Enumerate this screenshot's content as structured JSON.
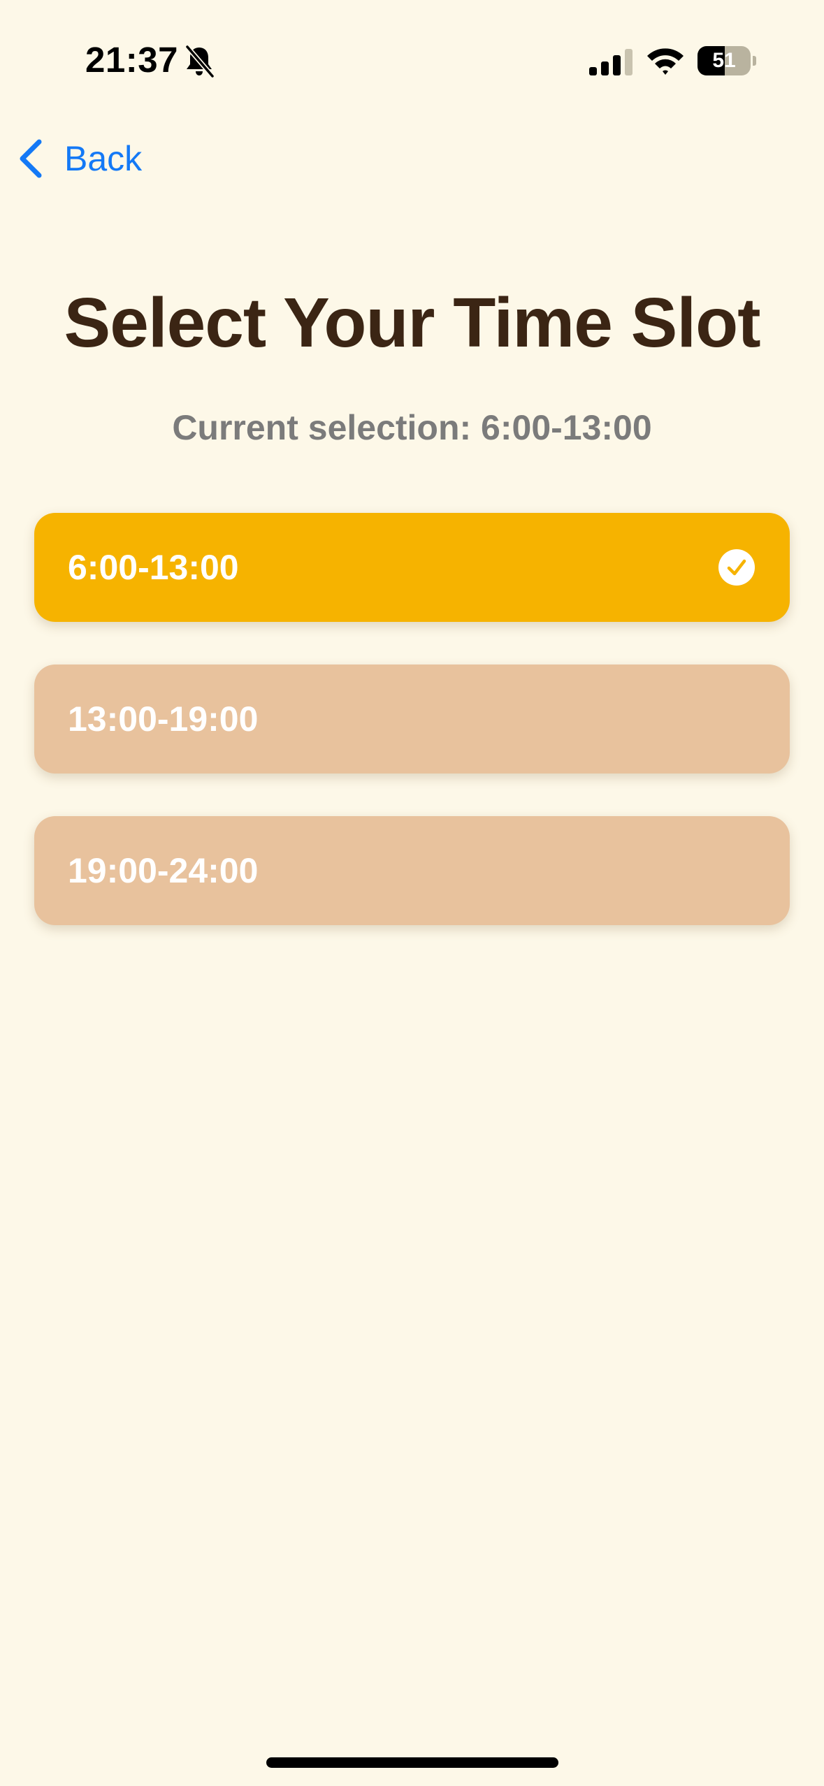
{
  "status_bar": {
    "time": "21:37",
    "battery_level": "51",
    "battery_fraction": 0.51,
    "silent_icon": "bell-slash-icon",
    "signal_icon": "cellular-signal-icon",
    "wifi_icon": "wifi-icon"
  },
  "nav": {
    "back_label": "Back",
    "back_icon": "chevron-left-icon"
  },
  "page": {
    "title": "Select Your Time Slot",
    "current_selection": "Current selection: 6:00-13:00"
  },
  "slots": [
    {
      "label": "6:00-13:00",
      "selected": true
    },
    {
      "label": "13:00-19:00",
      "selected": false
    },
    {
      "label": "19:00-24:00",
      "selected": false
    }
  ],
  "colors": {
    "background": "#FDF8E8",
    "accent_blue": "#1479F6",
    "title": "#3B2514",
    "subtitle": "#7B7B7B",
    "slot_selected": "#F6B300",
    "slot_unselected": "#E8C29D",
    "slot_text": "#FFFFFF"
  }
}
